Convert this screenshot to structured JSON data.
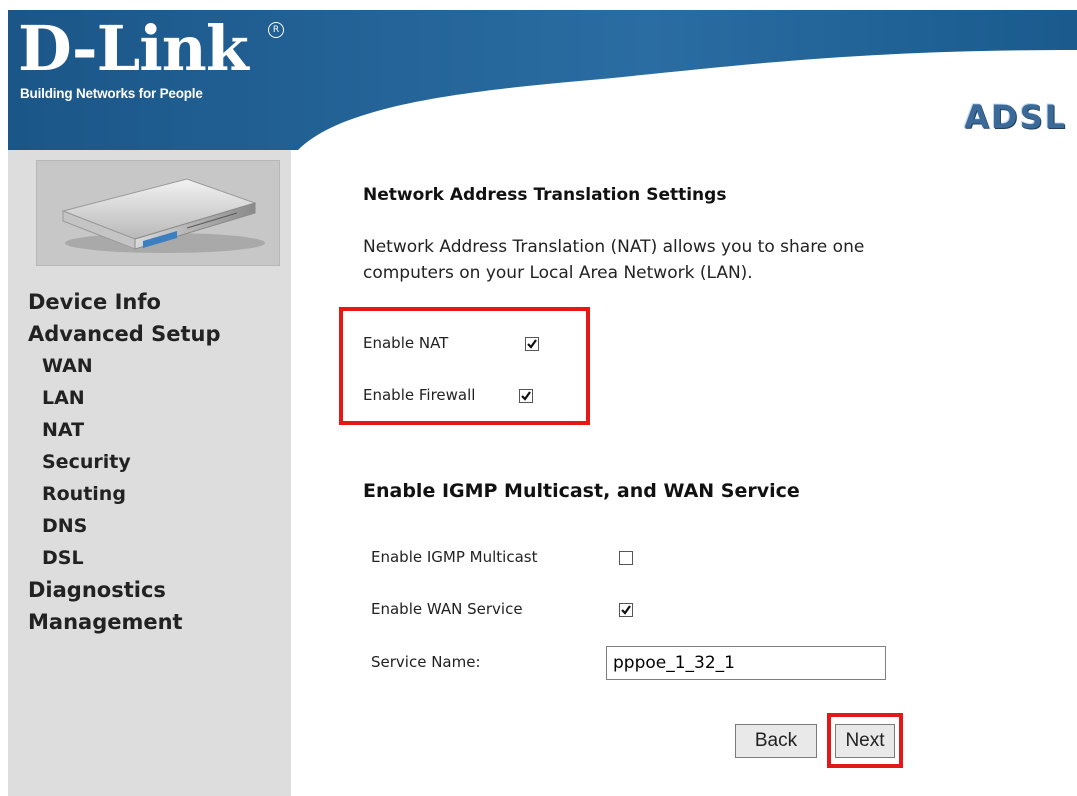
{
  "header": {
    "brand": "D-Link",
    "registered_mark": "R",
    "tagline": "Building Networks for People",
    "product": "ADSL",
    "colors": {
      "header_blue": "#1f5e90",
      "title_blue": "#3c6a98"
    }
  },
  "sidebar": {
    "image_icon": "router-device-image",
    "items": [
      {
        "label": "Device Info",
        "level": 0
      },
      {
        "label": "Advanced Setup",
        "level": 0
      },
      {
        "label": "WAN",
        "level": 1
      },
      {
        "label": "LAN",
        "level": 1
      },
      {
        "label": "NAT",
        "level": 1
      },
      {
        "label": "Security",
        "level": 1
      },
      {
        "label": "Routing",
        "level": 1
      },
      {
        "label": "DNS",
        "level": 1
      },
      {
        "label": "DSL",
        "level": 1
      },
      {
        "label": "Diagnostics",
        "level": 0
      },
      {
        "label": "Management",
        "level": 0
      }
    ]
  },
  "main": {
    "nat_section": {
      "title": "Network Address Translation Settings",
      "description_line1": "Network Address Translation (NAT) allows you to share one",
      "description_line2": "computers on your Local Area Network (LAN).",
      "enable_nat_label": "Enable NAT",
      "enable_nat_checked": true,
      "enable_firewall_label": "Enable Firewall",
      "enable_firewall_checked": true
    },
    "igmp_section": {
      "title": "Enable IGMP Multicast, and WAN Service",
      "igmp_label": "Enable IGMP Multicast",
      "igmp_checked": false,
      "wan_service_label": "Enable WAN Service",
      "wan_service_checked": true,
      "service_name_label": "Service Name:",
      "service_name_value": "pppoe_1_32_1"
    },
    "buttons": {
      "back_label": "Back",
      "next_label": "Next"
    },
    "highlight_color": "#e51818"
  }
}
